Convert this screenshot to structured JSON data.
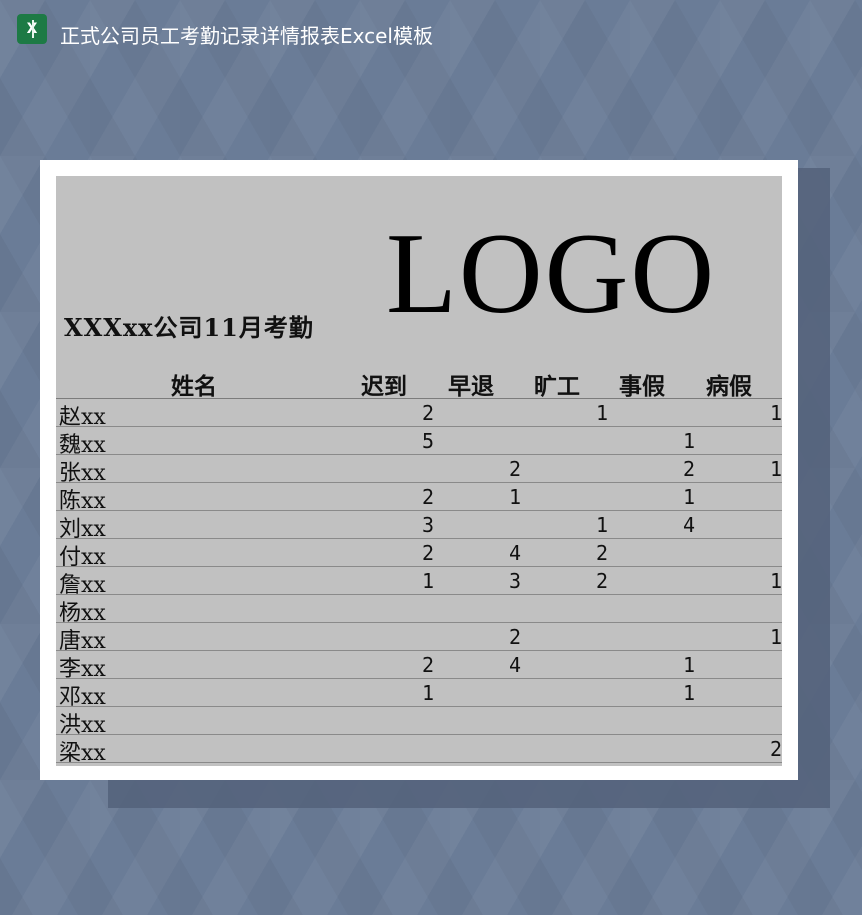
{
  "window": {
    "title": "正式公司员工考勤记录详情报表Excel模板"
  },
  "sheet": {
    "company_title": "XXXxx公司11月考勤",
    "logo_text": "LOGO",
    "headers": [
      "姓名",
      "迟到",
      "早退",
      "旷工",
      "事假",
      "病假"
    ],
    "rows": [
      {
        "name": "赵xx",
        "late": "2",
        "early": "",
        "absent": "1",
        "personal": "",
        "sick": "1"
      },
      {
        "name": "魏xx",
        "late": "5",
        "early": "",
        "absent": "",
        "personal": "1",
        "sick": ""
      },
      {
        "name": "张xx",
        "late": "",
        "early": "2",
        "absent": "",
        "personal": "2",
        "sick": "1"
      },
      {
        "name": "陈xx",
        "late": "2",
        "early": "1",
        "absent": "",
        "personal": "1",
        "sick": ""
      },
      {
        "name": "刘xx",
        "late": "3",
        "early": "",
        "absent": "1",
        "personal": "4",
        "sick": ""
      },
      {
        "name": "付xx",
        "late": "2",
        "early": "4",
        "absent": "2",
        "personal": "",
        "sick": ""
      },
      {
        "name": "詹xx",
        "late": "1",
        "early": "3",
        "absent": "2",
        "personal": "",
        "sick": "1"
      },
      {
        "name": "杨xx",
        "late": "",
        "early": "",
        "absent": "",
        "personal": "",
        "sick": ""
      },
      {
        "name": "唐xx",
        "late": "",
        "early": "2",
        "absent": "",
        "personal": "",
        "sick": "1"
      },
      {
        "name": "李xx",
        "late": "2",
        "early": "4",
        "absent": "",
        "personal": "1",
        "sick": ""
      },
      {
        "name": "邓xx",
        "late": "1",
        "early": "",
        "absent": "",
        "personal": "1",
        "sick": ""
      },
      {
        "name": "洪xx",
        "late": "",
        "early": "",
        "absent": "",
        "personal": "",
        "sick": ""
      },
      {
        "name": "梁xx",
        "late": "",
        "early": "",
        "absent": "",
        "personal": "",
        "sick": "2"
      }
    ]
  },
  "colors": {
    "background": "#6a7c97",
    "sheet": "#c1c1c1",
    "excel_icon": "#1d7a45"
  },
  "icons": {
    "app": "excel-icon"
  }
}
